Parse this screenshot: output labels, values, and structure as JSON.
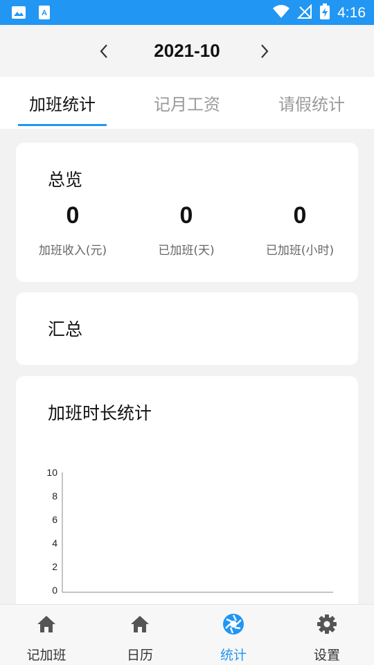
{
  "status_bar": {
    "time": "4:16"
  },
  "header": {
    "month": "2021-10"
  },
  "tabs": [
    {
      "label": "加班统计",
      "active": true
    },
    {
      "label": "记月工资",
      "active": false
    },
    {
      "label": "请假统计",
      "active": false
    }
  ],
  "overview": {
    "title": "总览",
    "stats": [
      {
        "value": "0",
        "label": "加班收入(元)"
      },
      {
        "value": "0",
        "label": "已加班(天)"
      },
      {
        "value": "0",
        "label": "已加班(小时)"
      }
    ]
  },
  "summary": {
    "title": "汇总"
  },
  "duration_chart": {
    "title": "加班时长统计"
  },
  "chart_data": {
    "type": "bar",
    "title": "加班时长统计",
    "categories": [],
    "values": [],
    "ylim": [
      0,
      10
    ],
    "yticks": [
      "0",
      "2",
      "4",
      "6",
      "8",
      "10"
    ],
    "grid": false
  },
  "bottom_nav": [
    {
      "label": "记加班",
      "icon": "home-icon",
      "active": false
    },
    {
      "label": "日历",
      "icon": "home-icon",
      "active": false
    },
    {
      "label": "统计",
      "icon": "aperture-icon",
      "active": true
    },
    {
      "label": "设置",
      "icon": "gear-icon",
      "active": false
    }
  ],
  "colors": {
    "accent": "#2196f3",
    "background": "#f2f2f2",
    "card": "#ffffff"
  }
}
